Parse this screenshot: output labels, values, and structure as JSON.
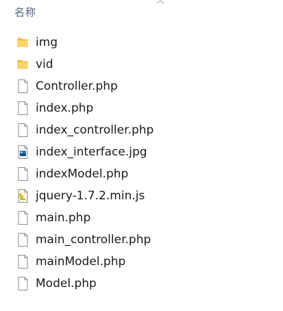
{
  "header": {
    "name_column_label": "名称"
  },
  "files": [
    {
      "name": "img",
      "icon": "folder-icon"
    },
    {
      "name": "vid",
      "icon": "folder-icon"
    },
    {
      "name": "Controller.php",
      "icon": "document-icon"
    },
    {
      "name": "index.php",
      "icon": "document-icon"
    },
    {
      "name": "index_controller.php",
      "icon": "document-icon"
    },
    {
      "name": "index_interface.jpg",
      "icon": "image-file-icon"
    },
    {
      "name": "indexModel.php",
      "icon": "document-icon"
    },
    {
      "name": "jquery-1.7.2.min.js",
      "icon": "script-file-icon"
    },
    {
      "name": "main.php",
      "icon": "document-icon"
    },
    {
      "name": "main_controller.php",
      "icon": "document-icon"
    },
    {
      "name": "mainModel.php",
      "icon": "document-icon"
    },
    {
      "name": "Model.php",
      "icon": "document-icon"
    }
  ],
  "colors": {
    "folder": "#f5c242",
    "header_text": "#4c607a"
  }
}
